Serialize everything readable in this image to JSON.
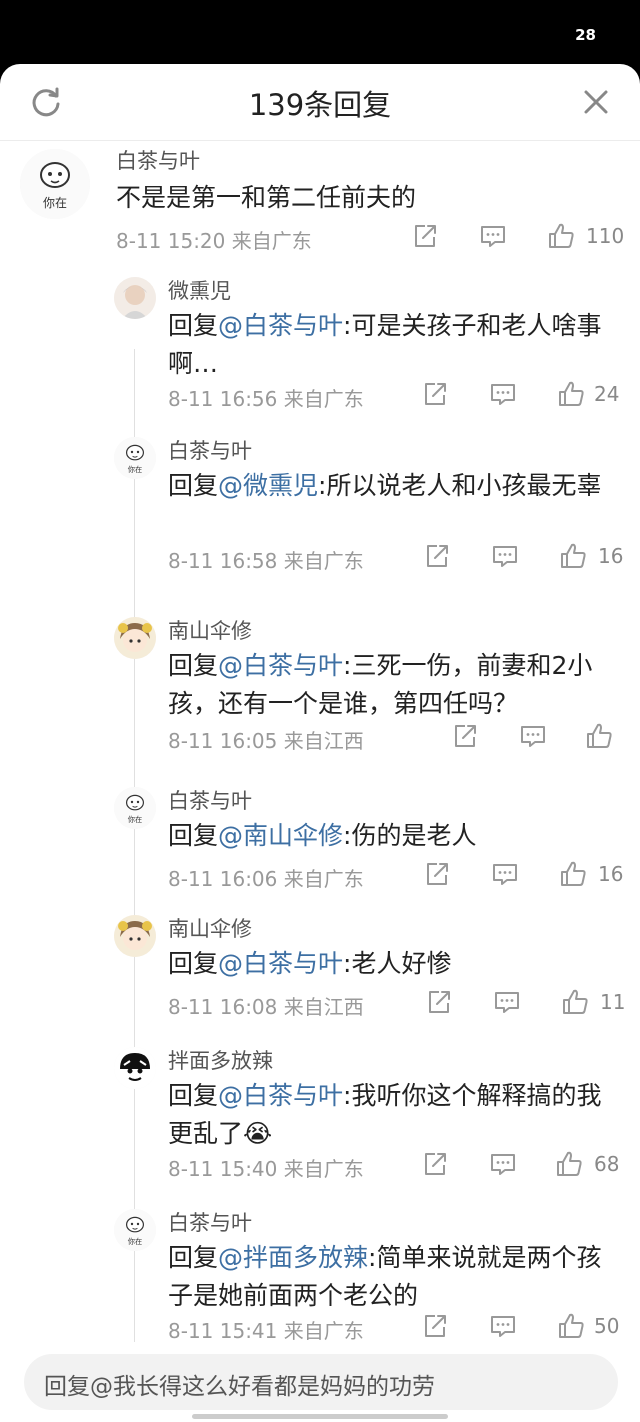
{
  "status_bar": {
    "time": "28"
  },
  "header": {
    "title": "139条回复"
  },
  "comments": [
    {
      "user": "白茶与叶",
      "text": "不是是第一和第二任前夫的",
      "time": "8-11 15:20",
      "location": "来自广东",
      "likes": "110"
    },
    {
      "user": "微熏児",
      "prefix": "回复",
      "mention": "@白茶与叶",
      "text": ":可是关孩子和老人啥事啊…",
      "time": "8-11 16:56",
      "location": "来自广东",
      "likes": "24"
    },
    {
      "user": "白茶与叶",
      "prefix": "回复",
      "mention": "@微熏児",
      "text": ":所以说老人和小孩最无辜",
      "time": "8-11 16:58",
      "location": "来自广东",
      "likes": "16"
    },
    {
      "user": "南山伞修",
      "prefix": "回复",
      "mention": "@白茶与叶",
      "text": ":三死一伤，前妻和2小孩，还有一个是谁，第四任吗？",
      "time": "8-11 16:05",
      "location": "来自江西",
      "likes": ""
    },
    {
      "user": "白茶与叶",
      "prefix": "回复",
      "mention": "@南山伞修",
      "text": ":伤的是老人",
      "time": "8-11 16:06",
      "location": "来自广东",
      "likes": "16"
    },
    {
      "user": "南山伞修",
      "prefix": "回复",
      "mention": "@白茶与叶",
      "text": ":老人好惨",
      "time": "8-11 16:08",
      "location": "来自江西",
      "likes": "11"
    },
    {
      "user": "拌面多放辣",
      "prefix": "回复",
      "mention": "@白茶与叶",
      "text": ":我听你这个解释搞的我更乱了😭",
      "time": "8-11 15:40",
      "location": "来自广东",
      "likes": "68"
    },
    {
      "user": "白茶与叶",
      "prefix": "回复",
      "mention": "@拌面多放辣",
      "text": ":简单来说就是两个孩子是她前面两个老公的",
      "time": "8-11 15:41",
      "location": "来自广东",
      "likes": "50"
    }
  ],
  "input": {
    "placeholder": "回复@我长得这么好看都是妈妈的功劳"
  }
}
